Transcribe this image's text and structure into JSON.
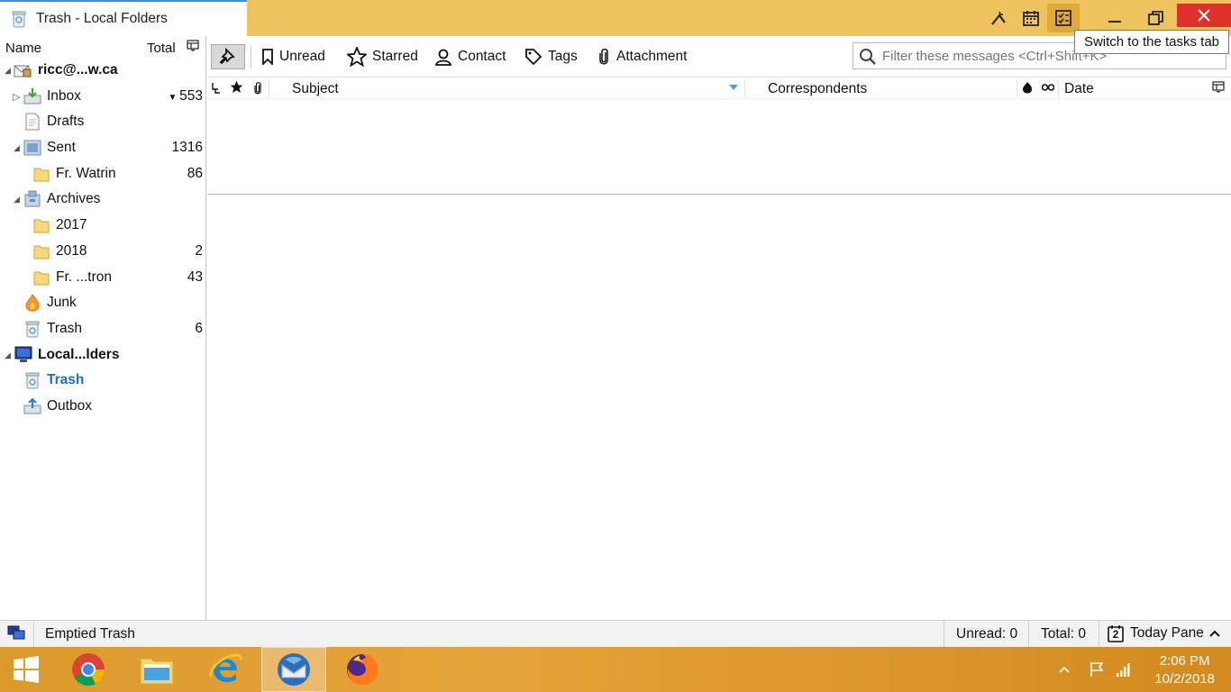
{
  "window": {
    "tab_title": "Trash - Local Folders",
    "tooltip": "Switch to the tasks tab",
    "accent": "#efc35d"
  },
  "folder_pane": {
    "col_name": "Name",
    "col_total": "Total",
    "rows": [
      {
        "label": "ricc@...w.ca",
        "count": "",
        "icon": "account-icon"
      },
      {
        "label": "Inbox",
        "count": "553",
        "icon": "inbox-icon"
      },
      {
        "label": "Drafts",
        "count": "",
        "icon": "drafts-icon"
      },
      {
        "label": "Sent",
        "count": "1316",
        "icon": "sent-icon"
      },
      {
        "label": "Fr.  Watrin",
        "count": "86",
        "icon": "folder-icon"
      },
      {
        "label": "Archives",
        "count": "",
        "icon": "archives-icon"
      },
      {
        "label": "2017",
        "count": "",
        "icon": "folder-icon"
      },
      {
        "label": "2018",
        "count": "2",
        "icon": "folder-icon"
      },
      {
        "label": "Fr. ...tron",
        "count": "43",
        "icon": "folder-icon"
      },
      {
        "label": "Junk",
        "count": "",
        "icon": "junk-icon"
      },
      {
        "label": "Trash",
        "count": "6",
        "icon": "trash-icon"
      },
      {
        "label": "Local...lders",
        "count": "",
        "icon": "local-folders-icon"
      },
      {
        "label": "Trash",
        "count": "",
        "icon": "trash-icon"
      },
      {
        "label": "Outbox",
        "count": "",
        "icon": "outbox-icon"
      }
    ]
  },
  "quick_filter": {
    "unread": "Unread",
    "starred": "Starred",
    "contact": "Contact",
    "tags": "Tags",
    "attachment": "Attachment",
    "search_placeholder": "Filter these messages <Ctrl+Shift+K>"
  },
  "columns": {
    "subject": "Subject",
    "correspondents": "Correspondents",
    "date": "Date"
  },
  "status": {
    "message": "Emptied Trash",
    "unread": "Unread: 0",
    "total": "Total: 0",
    "today_pane": "Today Pane",
    "today_day": "2"
  },
  "taskbar": {
    "time": "2:06 PM",
    "date": "10/2/2018"
  }
}
